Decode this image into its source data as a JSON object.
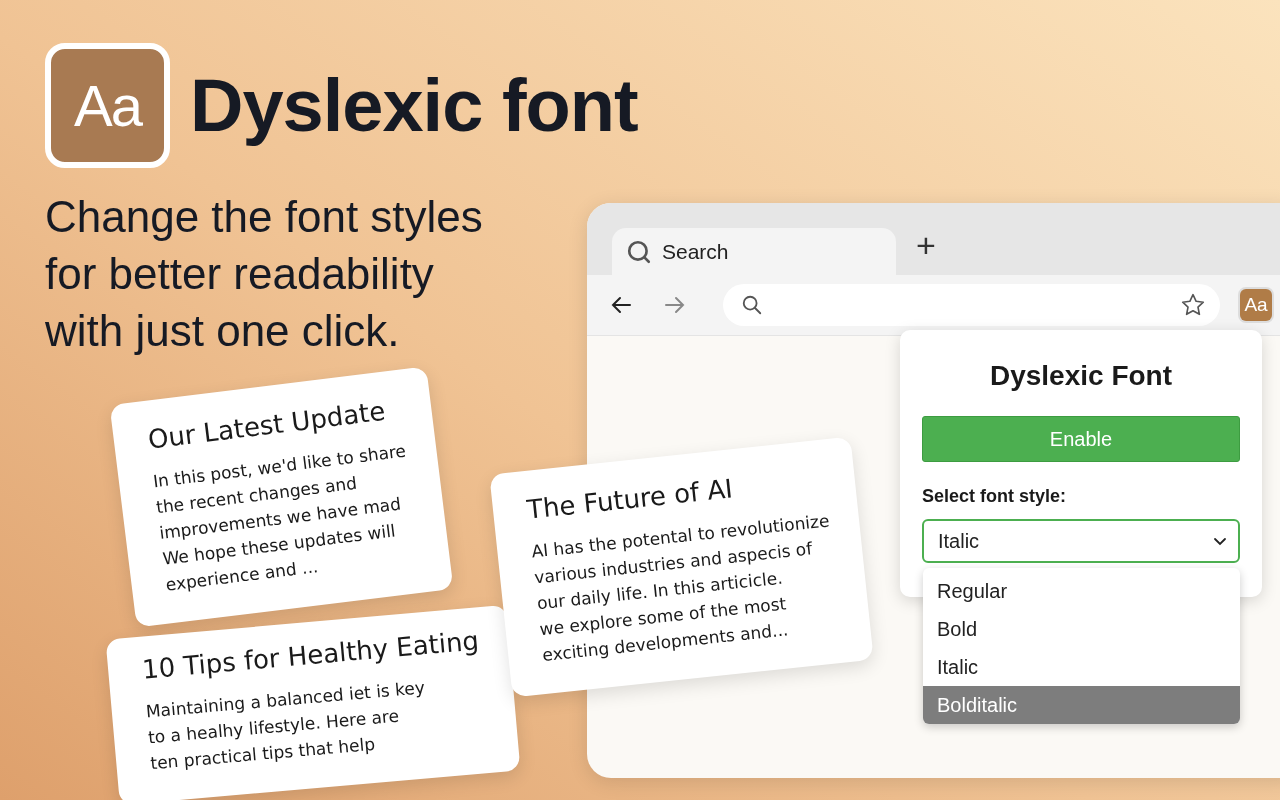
{
  "hero": {
    "icon_label": "Aa",
    "app_name": "Dyslexic font",
    "tagline": "Change the font styles for better readability with just one click."
  },
  "cards": [
    {
      "title": "Our Latest Update",
      "body": "In this post, we'd like to share\nthe recent changes and\nimprovements we have mad\nWe hope these updates will\nexperience and ..."
    },
    {
      "title": "10 Tips for Healthy Eating",
      "body": "Maintaining a balanced iet is key\nto a healhy lifestyle. Here are\nten practical tips that help"
    },
    {
      "title": "The Future of AI",
      "body": "AI has the potental to revolutionize\nvarious industries and aspecis of\nour daily life. In this articicle.\nwe explore some of the most\nexciting developments and..."
    }
  ],
  "browser": {
    "tabs": [
      {
        "label": "Search",
        "selected": true
      }
    ],
    "new_tab": "+",
    "extension_label": "Aa"
  },
  "popup": {
    "title": "Dyslexic Font",
    "enable_button": "Enable",
    "select_label": "Select font style:",
    "select_value": "Italic",
    "options": [
      {
        "label": "Regular",
        "selected": false
      },
      {
        "label": "Bold",
        "selected": false
      },
      {
        "label": "Italic",
        "selected": false
      },
      {
        "label": "Bolditalic",
        "selected": true
      }
    ]
  }
}
